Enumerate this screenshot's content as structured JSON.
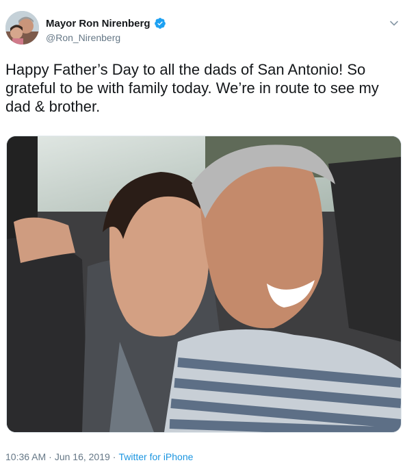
{
  "user": {
    "display_name": "Mayor Ron Nirenberg",
    "handle": "@Ron_Nirenberg",
    "verified_icon": "verified-badge-icon"
  },
  "tweet": {
    "text": "Happy Father’s Day to all the dads of San Antonio! So grateful to be with family today. We’re in route to see my dad & brother."
  },
  "meta": {
    "time": "10:36 AM",
    "separator1": "·",
    "date": "Jun 16, 2019",
    "separator2": "·",
    "source": "Twitter for iPhone"
  },
  "colors": {
    "verified_blue": "#1da1f2",
    "link_blue": "#1b95e0",
    "secondary_text": "#657786"
  }
}
